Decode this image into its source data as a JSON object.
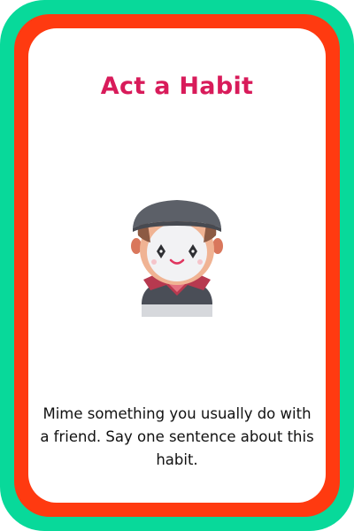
{
  "card": {
    "title": "Act a Habit",
    "prompt": "Mime something you usually do with a friend. Say one sentence about this habit.",
    "illustration_icon": "mime-icon"
  },
  "colors": {
    "outer_border": "#08d99a",
    "inner_border": "#ff3a10",
    "title": "#d81b5a",
    "background": "#ffffff"
  }
}
